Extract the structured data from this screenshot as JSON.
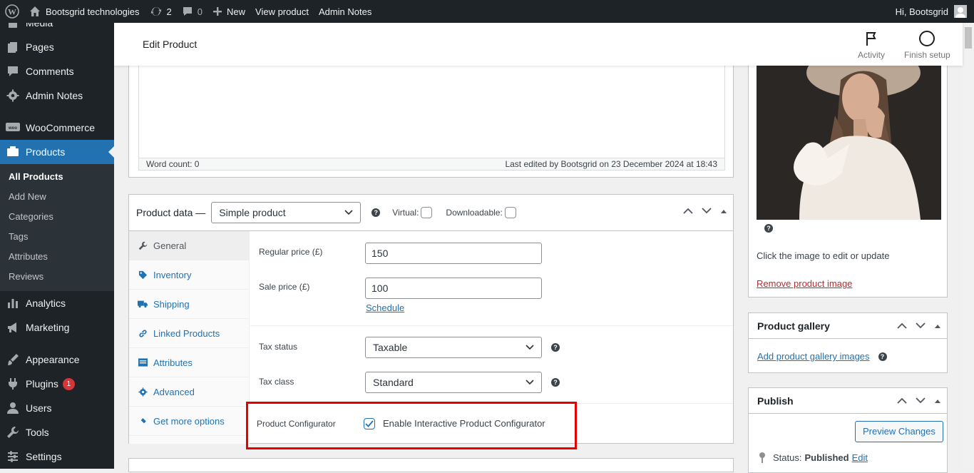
{
  "adminbar": {
    "site_name": "Bootsgrid technologies",
    "updates_count": "2",
    "comments_count": "0",
    "new_label": "New",
    "view_product": "View product",
    "admin_notes": "Admin Notes",
    "greeting": "Hi, Bootsgrid"
  },
  "sidebar": {
    "media": "Media",
    "pages": "Pages",
    "comments": "Comments",
    "admin_notes": "Admin Notes",
    "woocommerce": "WooCommerce",
    "products": "Products",
    "sub": [
      "All Products",
      "Add New",
      "Categories",
      "Tags",
      "Attributes",
      "Reviews"
    ],
    "analytics": "Analytics",
    "marketing": "Marketing",
    "appearance": "Appearance",
    "plugins": "Plugins",
    "plugins_badge": "1",
    "users": "Users",
    "tools": "Tools",
    "settings": "Settings"
  },
  "header": {
    "title": "Edit Product",
    "activity": "Activity",
    "finish_setup": "Finish setup"
  },
  "editor": {
    "word_count": "Word count: 0",
    "last_edited": "Last edited by Bootsgrid on 23 December 2024 at 18:43"
  },
  "product_data": {
    "title": "Product data —",
    "type_value": "Simple product",
    "virtual_label": "Virtual:",
    "downloadable_label": "Downloadable:",
    "tabs": [
      "General",
      "Inventory",
      "Shipping",
      "Linked Products",
      "Attributes",
      "Advanced",
      "Get more options"
    ],
    "regular_price_label": "Regular price (£)",
    "regular_price_value": "150",
    "sale_price_label": "Sale price (£)",
    "sale_price_value": "100",
    "schedule_link": "Schedule",
    "tax_status_label": "Tax status",
    "tax_status_value": "Taxable",
    "tax_class_label": "Tax class",
    "tax_class_value": "Standard",
    "configurator_label": "Product Configurator",
    "configurator_checkbox_label": "Enable Interactive Product Configurator",
    "configurator_checked": true
  },
  "product_image": {
    "hint": "Click the image to edit or update",
    "remove_link": "Remove product image"
  },
  "gallery": {
    "title": "Product gallery",
    "add_link": "Add product gallery images"
  },
  "publish": {
    "title": "Publish",
    "preview_button": "Preview Changes",
    "status_label": "Status:",
    "status_value": "Published",
    "edit_link": "Edit"
  },
  "colors": {
    "admin_dark": "#1d2327",
    "accent": "#2271b1",
    "highlight_border": "#e60000",
    "badge": "#d63638"
  }
}
